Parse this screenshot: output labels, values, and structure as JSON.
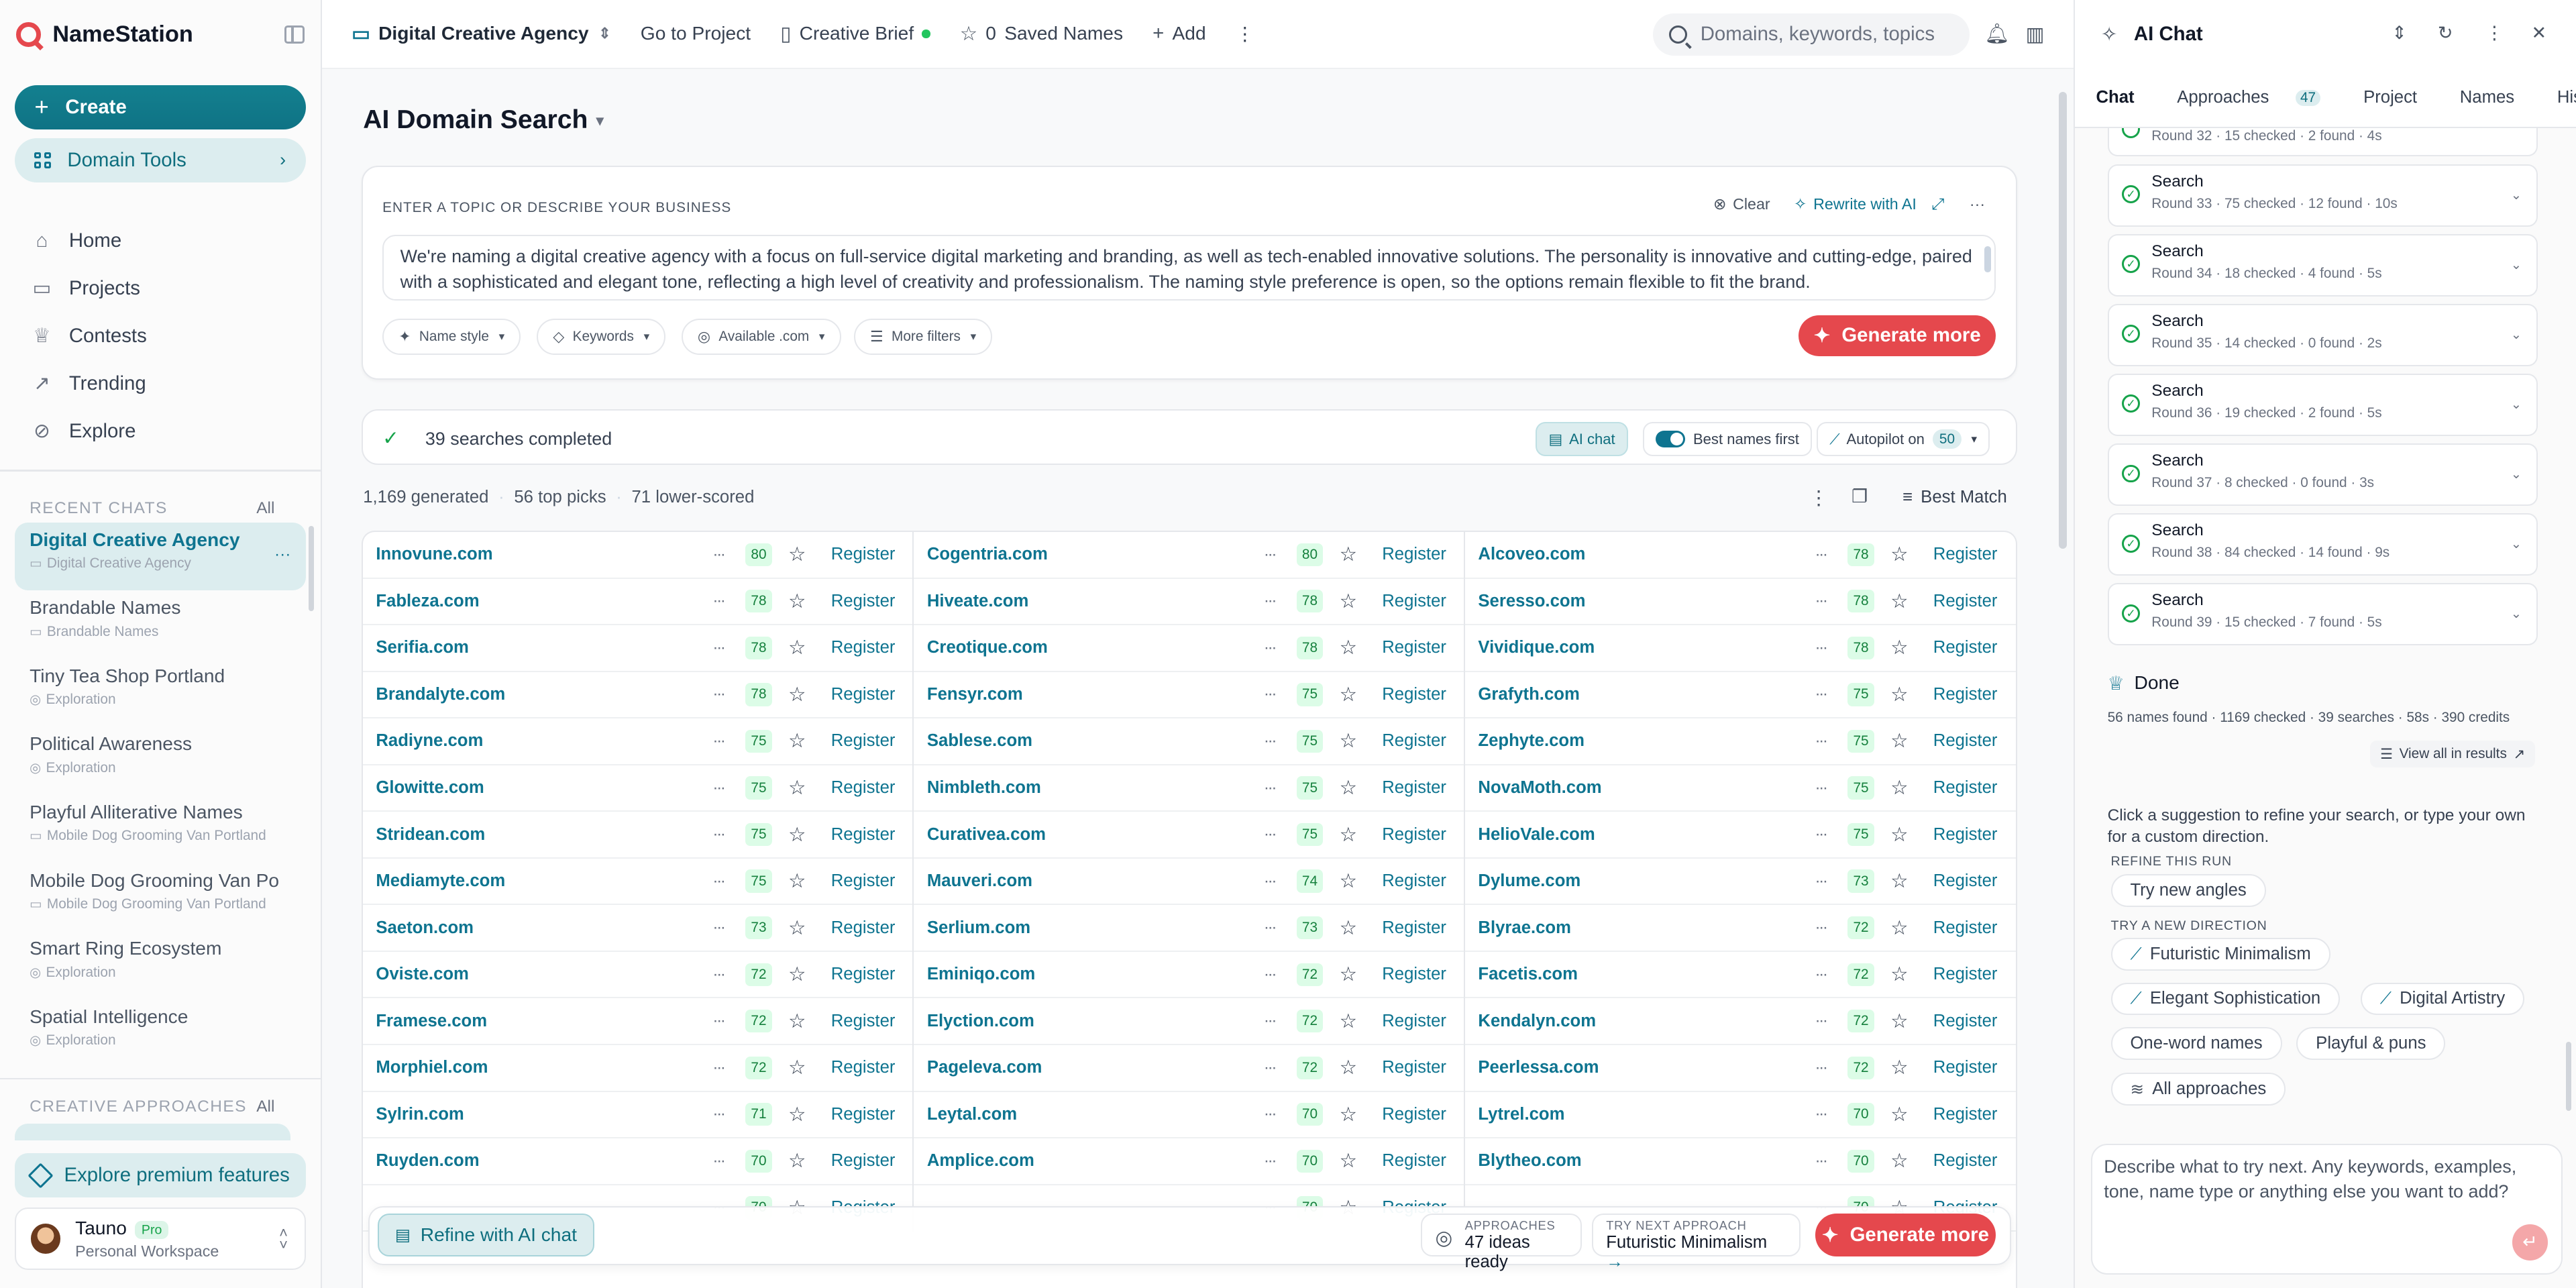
{
  "brand": {
    "name": "NameStation"
  },
  "sidebar": {
    "create_label": "Create",
    "tools_label": "Domain Tools",
    "nav": [
      {
        "label": "Home",
        "icon": "home-icon"
      },
      {
        "label": "Projects",
        "icon": "folder-icon"
      },
      {
        "label": "Contests",
        "icon": "trophy-icon"
      },
      {
        "label": "Trending",
        "icon": "trending-icon"
      },
      {
        "label": "Explore",
        "icon": "compass-icon"
      }
    ],
    "recent_title": "RECENT CHATS",
    "recent_all": "All",
    "chats": [
      {
        "title": "Digital Creative Agency",
        "sub": "Digital Creative Agency"
      },
      {
        "title": "Brandable Names",
        "sub": "Brandable Names"
      },
      {
        "title": "Tiny Tea Shop Portland",
        "sub": "Exploration"
      },
      {
        "title": "Political Awareness",
        "sub": "Exploration"
      },
      {
        "title": "Playful Alliterative Names",
        "sub": "Mobile Dog Grooming Van Portland"
      },
      {
        "title": "Mobile Dog Grooming Van Po",
        "sub": "Mobile Dog Grooming Van Portland"
      },
      {
        "title": "Smart Ring Ecosystem",
        "sub": "Exploration"
      },
      {
        "title": "Spatial Intelligence",
        "sub": "Exploration"
      }
    ],
    "approaches_title": "CREATIVE APPROACHES",
    "approaches_all": "All",
    "premium_label": "Explore premium features",
    "user": {
      "name": "Tauno",
      "badge": "Pro",
      "workspace": "Personal Workspace"
    }
  },
  "topbar": {
    "project": "Digital Creative Agency",
    "goto": "Go to Project",
    "brief": "Creative Brief",
    "saved_count": "0",
    "saved_label": "Saved Names",
    "add": "Add",
    "search_placeholder": "Domains, keywords, topics"
  },
  "main": {
    "title": "AI Domain Search",
    "input_label": "ENTER A TOPIC OR DESCRIBE YOUR BUSINESS",
    "clear": "Clear",
    "rewrite": "Rewrite with AI",
    "description": "We're naming a digital creative agency with a focus on full-service digital marketing and branding, as well as tech-enabled innovative solutions. The personality is innovative and cutting-edge, paired with a sophisticated and elegant tone, reflecting a high level of creativity and professionalism. The naming style preference is open, so the options remain flexible to fit the brand.",
    "chips": [
      "Name style",
      "Keywords",
      "Available .com",
      "More filters"
    ],
    "generate": "Generate more",
    "status_text": "39 searches completed",
    "ai_chat": "AI chat",
    "best_first": "Best names first",
    "autopilot": "Autopilot on",
    "autopilot_count": "50",
    "stats": [
      "1,169 generated",
      "56 top picks",
      "71 lower-scored"
    ],
    "sort": "Best Match",
    "register": "Register",
    "columns": [
      [
        [
          "Innovune.com",
          "80"
        ],
        [
          "Fableza.com",
          "78"
        ],
        [
          "Serifia.com",
          "78"
        ],
        [
          "Brandalyte.com",
          "78"
        ],
        [
          "Radiyne.com",
          "75"
        ],
        [
          "Glowitte.com",
          "75"
        ],
        [
          "Stridean.com",
          "75"
        ],
        [
          "Mediamyte.com",
          "75"
        ],
        [
          "Saeton.com",
          "73"
        ],
        [
          "Oviste.com",
          "72"
        ],
        [
          "Framese.com",
          "72"
        ],
        [
          "Morphiel.com",
          "72"
        ],
        [
          "Sylrin.com",
          "71"
        ],
        [
          "Ruyden.com",
          "70"
        ],
        [
          "",
          "70"
        ]
      ],
      [
        [
          "Cogentria.com",
          "80"
        ],
        [
          "Hiveate.com",
          "78"
        ],
        [
          "Creotique.com",
          "78"
        ],
        [
          "Fensyr.com",
          "75"
        ],
        [
          "Sablese.com",
          "75"
        ],
        [
          "Nimbleth.com",
          "75"
        ],
        [
          "Curativea.com",
          "75"
        ],
        [
          "Mauveri.com",
          "74"
        ],
        [
          "Serlium.com",
          "73"
        ],
        [
          "Eminiqo.com",
          "72"
        ],
        [
          "Elyction.com",
          "72"
        ],
        [
          "Pageleva.com",
          "72"
        ],
        [
          "Leytal.com",
          "70"
        ],
        [
          "Amplice.com",
          "70"
        ],
        [
          "",
          "70"
        ]
      ],
      [
        [
          "Alcoveo.com",
          "78"
        ],
        [
          "Seresso.com",
          "78"
        ],
        [
          "Vividique.com",
          "78"
        ],
        [
          "Grafyth.com",
          "75"
        ],
        [
          "Zephyte.com",
          "75"
        ],
        [
          "NovaMoth.com",
          "75"
        ],
        [
          "HelioVale.com",
          "75"
        ],
        [
          "Dylume.com",
          "73"
        ],
        [
          "Blyrae.com",
          "72"
        ],
        [
          "Facetis.com",
          "72"
        ],
        [
          "Kendalyn.com",
          "72"
        ],
        [
          "Peerlessa.com",
          "72"
        ],
        [
          "Lytrel.com",
          "70"
        ],
        [
          "Blytheo.com",
          "70"
        ],
        [
          "",
          "70"
        ]
      ]
    ],
    "bottom": {
      "refine": "Refine with AI chat",
      "approaches_k": "APPROACHES",
      "approaches_v": "47 ideas ready",
      "next_k": "TRY NEXT APPROACH",
      "next_v": "Futuristic Minimalism",
      "generate": "Generate more"
    }
  },
  "chat": {
    "title": "AI Chat",
    "tabs": [
      {
        "label": "Chat"
      },
      {
        "label": "Approaches",
        "count": "47"
      },
      {
        "label": "Project"
      },
      {
        "label": "Names"
      },
      {
        "label": "History"
      }
    ],
    "searches": [
      {
        "t": "Search",
        "s": "Round 33 · 75 checked · 12 found · 10s"
      },
      {
        "t": "Search",
        "s": "Round 34 · 18 checked · 4 found · 5s"
      },
      {
        "t": "Search",
        "s": "Round 35 · 14 checked · 0 found · 2s"
      },
      {
        "t": "Search",
        "s": "Round 36 · 19 checked · 2 found · 5s"
      },
      {
        "t": "Search",
        "s": "Round 37 · 8 checked · 0 found · 3s"
      },
      {
        "t": "Search",
        "s": "Round 38 · 84 checked · 14 found · 9s"
      },
      {
        "t": "Search",
        "s": "Round 39 · 15 checked · 7 found · 5s"
      }
    ],
    "partial_round": "Round 32 · 15 checked · 2 found · 4s",
    "done": "Done",
    "done_sub": "56 names found · 1169 checked · 39 searches · 58s · 390 credits",
    "view_all": "View all in results",
    "hint": "Click a suggestion to refine your search, or type your own for a custom direction.",
    "refine_title": "REFINE THIS RUN",
    "try_angles": "Try new angles",
    "new_dir_title": "TRY A NEW DIRECTION",
    "directions": [
      "Futuristic Minimalism",
      "Elegant Sophistication",
      "Digital Artistry",
      "One-word names",
      "Playful & puns",
      "All approaches"
    ],
    "composer_placeholder": "Describe what to try next. Any keywords, examples, tone, name type or anything else you want to add?"
  }
}
